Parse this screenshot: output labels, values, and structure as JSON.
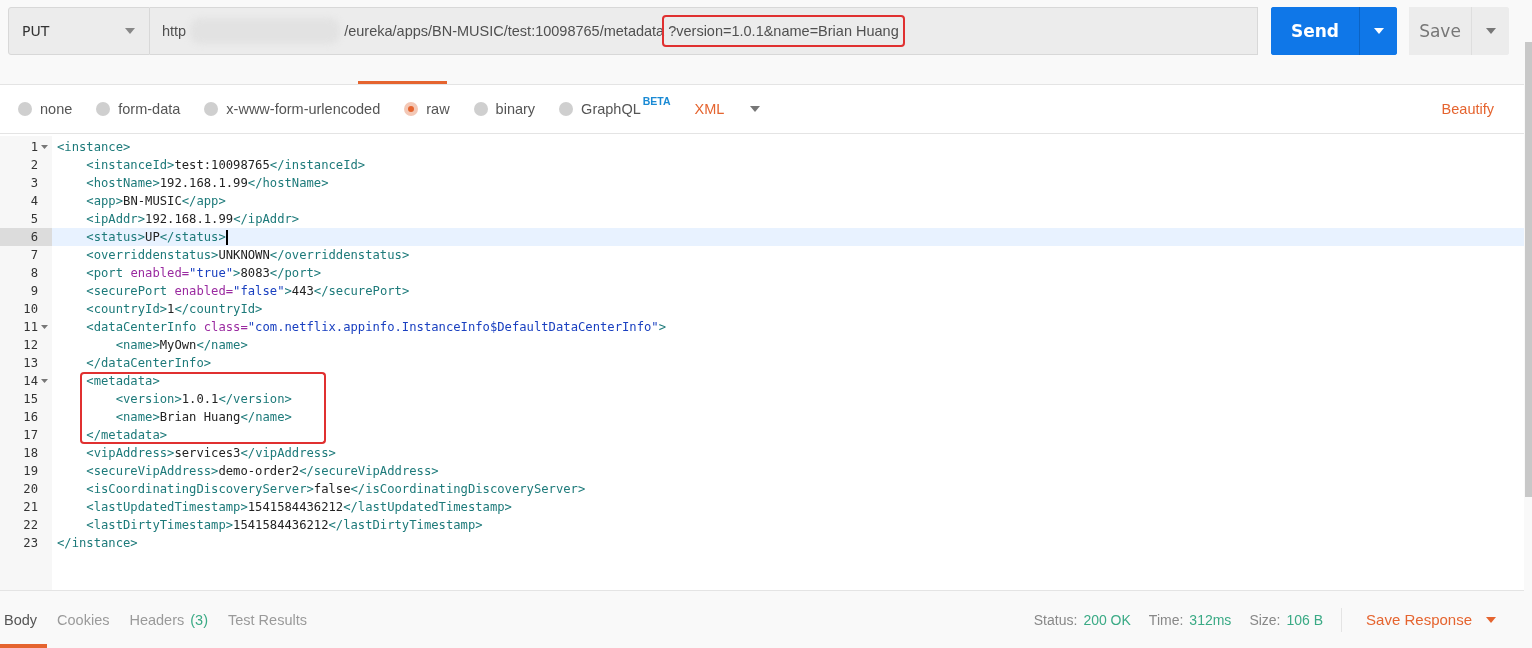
{
  "request": {
    "method": "PUT",
    "url_parts": [
      {
        "kind": "text",
        "text": "http"
      },
      {
        "kind": "redacted"
      },
      {
        "kind": "text",
        "text": "/eureka/apps/BN-MUSIC/test:10098765/metadata"
      },
      {
        "kind": "boxed",
        "text": "?version=1.0.1&name=Brian Huang"
      }
    ],
    "send": "Send",
    "save": "Save"
  },
  "body_types": [
    {
      "label": "none",
      "selected": false
    },
    {
      "label": "form-data",
      "selected": false
    },
    {
      "label": "x-www-form-urlencoded",
      "selected": false
    },
    {
      "label": "raw",
      "selected": true
    },
    {
      "label": "binary",
      "selected": false
    },
    {
      "label": "GraphQL",
      "badge": "BETA",
      "selected": false
    }
  ],
  "format": "XML",
  "beautify": "Beautify",
  "editor_lines": [
    {
      "number": "1",
      "foldable": true,
      "current": false,
      "boxed": false,
      "tokens": [
        {
          "kind": "tag",
          "text": "<instance>"
        }
      ]
    },
    {
      "number": "2",
      "foldable": false,
      "current": false,
      "boxed": false,
      "tokens": [
        {
          "kind": "tag",
          "text": "    <instanceId>"
        },
        {
          "kind": "text",
          "text": "test:10098765"
        },
        {
          "kind": "tag",
          "text": "</instanceId>"
        }
      ]
    },
    {
      "number": "3",
      "foldable": false,
      "current": false,
      "boxed": false,
      "tokens": [
        {
          "kind": "tag",
          "text": "    <hostName>"
        },
        {
          "kind": "text",
          "text": "192.168.1.99"
        },
        {
          "kind": "tag",
          "text": "</hostName>"
        }
      ]
    },
    {
      "number": "4",
      "foldable": false,
      "current": false,
      "boxed": false,
      "tokens": [
        {
          "kind": "tag",
          "text": "    <app>"
        },
        {
          "kind": "text",
          "text": "BN-MUSIC"
        },
        {
          "kind": "tag",
          "text": "</app>"
        }
      ]
    },
    {
      "number": "5",
      "foldable": false,
      "current": false,
      "boxed": false,
      "tokens": [
        {
          "kind": "tag",
          "text": "    <ipAddr>"
        },
        {
          "kind": "text",
          "text": "192.168.1.99"
        },
        {
          "kind": "tag",
          "text": "</ipAddr>"
        }
      ]
    },
    {
      "number": "6",
      "foldable": false,
      "current": true,
      "boxed": false,
      "tokens": [
        {
          "kind": "tag",
          "text": "    <status>"
        },
        {
          "kind": "text",
          "text": "UP"
        },
        {
          "kind": "tag",
          "text": "</status>"
        }
      ]
    },
    {
      "number": "7",
      "foldable": false,
      "current": false,
      "boxed": false,
      "tokens": [
        {
          "kind": "tag",
          "text": "    <overriddenstatus>"
        },
        {
          "kind": "text",
          "text": "UNKNOWN"
        },
        {
          "kind": "tag",
          "text": "</overriddenstatus>"
        }
      ]
    },
    {
      "number": "8",
      "foldable": false,
      "current": false,
      "boxed": false,
      "tokens": [
        {
          "kind": "tag",
          "text": "    <port "
        },
        {
          "kind": "attr",
          "text": "enabled="
        },
        {
          "kind": "value",
          "text": "\"true\""
        },
        {
          "kind": "tag",
          "text": ">"
        },
        {
          "kind": "text",
          "text": "8083"
        },
        {
          "kind": "tag",
          "text": "</port>"
        }
      ]
    },
    {
      "number": "9",
      "foldable": false,
      "current": false,
      "boxed": false,
      "tokens": [
        {
          "kind": "tag",
          "text": "    <securePort "
        },
        {
          "kind": "attr",
          "text": "enabled="
        },
        {
          "kind": "value",
          "text": "\"false\""
        },
        {
          "kind": "tag",
          "text": ">"
        },
        {
          "kind": "text",
          "text": "443"
        },
        {
          "kind": "tag",
          "text": "</securePort>"
        }
      ]
    },
    {
      "number": "10",
      "foldable": false,
      "current": false,
      "boxed": false,
      "tokens": [
        {
          "kind": "tag",
          "text": "    <countryId>"
        },
        {
          "kind": "text",
          "text": "1"
        },
        {
          "kind": "tag",
          "text": "</countryId>"
        }
      ]
    },
    {
      "number": "11",
      "foldable": true,
      "current": false,
      "boxed": false,
      "tokens": [
        {
          "kind": "tag",
          "text": "    <dataCenterInfo "
        },
        {
          "kind": "attr",
          "text": "class="
        },
        {
          "kind": "value",
          "text": "\"com.netflix.appinfo.InstanceInfo$DefaultDataCenterInfo\""
        },
        {
          "kind": "tag",
          "text": ">"
        }
      ]
    },
    {
      "number": "12",
      "foldable": false,
      "current": false,
      "boxed": false,
      "tokens": [
        {
          "kind": "tag",
          "text": "        <name>"
        },
        {
          "kind": "text",
          "text": "MyOwn"
        },
        {
          "kind": "tag",
          "text": "</name>"
        }
      ]
    },
    {
      "number": "13",
      "foldable": false,
      "current": false,
      "boxed": false,
      "tokens": [
        {
          "kind": "tag",
          "text": "    </dataCenterInfo>"
        }
      ]
    },
    {
      "number": "14",
      "foldable": true,
      "current": false,
      "boxed": true,
      "tokens": [
        {
          "kind": "tag",
          "text": "    <metadata>"
        }
      ]
    },
    {
      "number": "15",
      "foldable": false,
      "current": false,
      "boxed": true,
      "tokens": [
        {
          "kind": "tag",
          "text": "        <version>"
        },
        {
          "kind": "text",
          "text": "1.0.1"
        },
        {
          "kind": "tag",
          "text": "</version>"
        }
      ]
    },
    {
      "number": "16",
      "foldable": false,
      "current": false,
      "boxed": true,
      "tokens": [
        {
          "kind": "tag",
          "text": "        <name>"
        },
        {
          "kind": "text",
          "text": "Brian Huang"
        },
        {
          "kind": "tag",
          "text": "</name>"
        }
      ]
    },
    {
      "number": "17",
      "foldable": false,
      "current": false,
      "boxed": true,
      "tokens": [
        {
          "kind": "tag",
          "text": "    </metadata>"
        }
      ]
    },
    {
      "number": "18",
      "foldable": false,
      "current": false,
      "boxed": false,
      "tokens": [
        {
          "kind": "tag",
          "text": "    <vipAddress>"
        },
        {
          "kind": "text",
          "text": "services3"
        },
        {
          "kind": "tag",
          "text": "</vipAddress>"
        }
      ]
    },
    {
      "number": "19",
      "foldable": false,
      "current": false,
      "boxed": false,
      "tokens": [
        {
          "kind": "tag",
          "text": "    <secureVipAddress>"
        },
        {
          "kind": "text",
          "text": "demo-order2"
        },
        {
          "kind": "tag",
          "text": "</secureVipAddress>"
        }
      ]
    },
    {
      "number": "20",
      "foldable": false,
      "current": false,
      "boxed": false,
      "tokens": [
        {
          "kind": "tag",
          "text": "    <isCoordinatingDiscoveryServer>"
        },
        {
          "kind": "text",
          "text": "false"
        },
        {
          "kind": "tag",
          "text": "</isCoordinatingDiscoveryServer>"
        }
      ]
    },
    {
      "number": "21",
      "foldable": false,
      "current": false,
      "boxed": false,
      "tokens": [
        {
          "kind": "tag",
          "text": "    <lastUpdatedTimestamp>"
        },
        {
          "kind": "text",
          "text": "1541584436212"
        },
        {
          "kind": "tag",
          "text": "</lastUpdatedTimestamp>"
        }
      ]
    },
    {
      "number": "22",
      "foldable": false,
      "current": false,
      "boxed": false,
      "tokens": [
        {
          "kind": "tag",
          "text": "    <lastDirtyTimestamp>"
        },
        {
          "kind": "text",
          "text": "1541584436212"
        },
        {
          "kind": "tag",
          "text": "</lastDirtyTimestamp>"
        }
      ]
    },
    {
      "number": "23",
      "foldable": false,
      "current": false,
      "boxed": false,
      "tokens": [
        {
          "kind": "tag",
          "text": "</instance>"
        }
      ]
    }
  ],
  "response_tabs": [
    {
      "label": "Body",
      "selected": true
    },
    {
      "label": "Cookies",
      "selected": false
    },
    {
      "label": "Headers",
      "count": "(3)",
      "selected": false
    },
    {
      "label": "Test Results",
      "selected": false
    }
  ],
  "response_stats": [
    {
      "label": "Status:",
      "value": "200 OK"
    },
    {
      "label": "Time:",
      "value": "312ms"
    },
    {
      "label": "Size:",
      "value": "106 B"
    }
  ],
  "save_response": "Save Response"
}
